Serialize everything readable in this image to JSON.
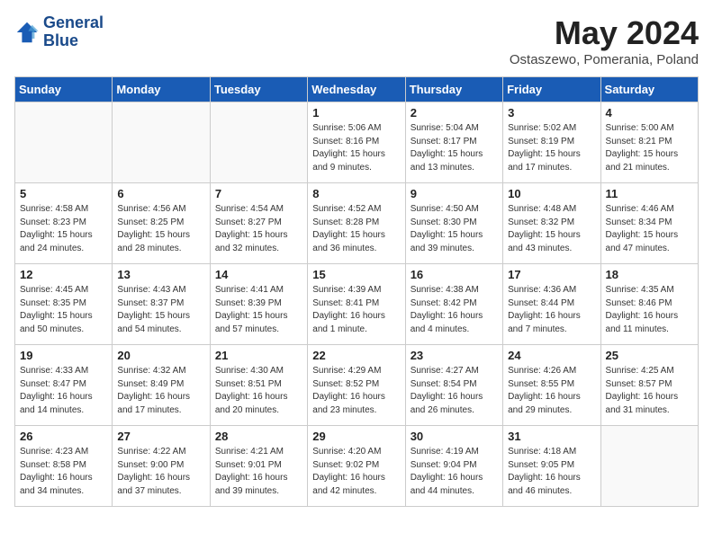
{
  "header": {
    "logo_line1": "General",
    "logo_line2": "Blue",
    "month": "May 2024",
    "location": "Ostaszewo, Pomerania, Poland"
  },
  "days_of_week": [
    "Sunday",
    "Monday",
    "Tuesday",
    "Wednesday",
    "Thursday",
    "Friday",
    "Saturday"
  ],
  "weeks": [
    [
      {
        "day": "",
        "empty": true
      },
      {
        "day": "",
        "empty": true
      },
      {
        "day": "",
        "empty": true
      },
      {
        "day": "1",
        "sunrise": "5:06 AM",
        "sunset": "8:16 PM",
        "daylight": "15 hours and 9 minutes."
      },
      {
        "day": "2",
        "sunrise": "5:04 AM",
        "sunset": "8:17 PM",
        "daylight": "15 hours and 13 minutes."
      },
      {
        "day": "3",
        "sunrise": "5:02 AM",
        "sunset": "8:19 PM",
        "daylight": "15 hours and 17 minutes."
      },
      {
        "day": "4",
        "sunrise": "5:00 AM",
        "sunset": "8:21 PM",
        "daylight": "15 hours and 21 minutes."
      }
    ],
    [
      {
        "day": "5",
        "sunrise": "4:58 AM",
        "sunset": "8:23 PM",
        "daylight": "15 hours and 24 minutes."
      },
      {
        "day": "6",
        "sunrise": "4:56 AM",
        "sunset": "8:25 PM",
        "daylight": "15 hours and 28 minutes."
      },
      {
        "day": "7",
        "sunrise": "4:54 AM",
        "sunset": "8:27 PM",
        "daylight": "15 hours and 32 minutes."
      },
      {
        "day": "8",
        "sunrise": "4:52 AM",
        "sunset": "8:28 PM",
        "daylight": "15 hours and 36 minutes."
      },
      {
        "day": "9",
        "sunrise": "4:50 AM",
        "sunset": "8:30 PM",
        "daylight": "15 hours and 39 minutes."
      },
      {
        "day": "10",
        "sunrise": "4:48 AM",
        "sunset": "8:32 PM",
        "daylight": "15 hours and 43 minutes."
      },
      {
        "day": "11",
        "sunrise": "4:46 AM",
        "sunset": "8:34 PM",
        "daylight": "15 hours and 47 minutes."
      }
    ],
    [
      {
        "day": "12",
        "sunrise": "4:45 AM",
        "sunset": "8:35 PM",
        "daylight": "15 hours and 50 minutes."
      },
      {
        "day": "13",
        "sunrise": "4:43 AM",
        "sunset": "8:37 PM",
        "daylight": "15 hours and 54 minutes."
      },
      {
        "day": "14",
        "sunrise": "4:41 AM",
        "sunset": "8:39 PM",
        "daylight": "15 hours and 57 minutes."
      },
      {
        "day": "15",
        "sunrise": "4:39 AM",
        "sunset": "8:41 PM",
        "daylight": "16 hours and 1 minute."
      },
      {
        "day": "16",
        "sunrise": "4:38 AM",
        "sunset": "8:42 PM",
        "daylight": "16 hours and 4 minutes."
      },
      {
        "day": "17",
        "sunrise": "4:36 AM",
        "sunset": "8:44 PM",
        "daylight": "16 hours and 7 minutes."
      },
      {
        "day": "18",
        "sunrise": "4:35 AM",
        "sunset": "8:46 PM",
        "daylight": "16 hours and 11 minutes."
      }
    ],
    [
      {
        "day": "19",
        "sunrise": "4:33 AM",
        "sunset": "8:47 PM",
        "daylight": "16 hours and 14 minutes."
      },
      {
        "day": "20",
        "sunrise": "4:32 AM",
        "sunset": "8:49 PM",
        "daylight": "16 hours and 17 minutes."
      },
      {
        "day": "21",
        "sunrise": "4:30 AM",
        "sunset": "8:51 PM",
        "daylight": "16 hours and 20 minutes."
      },
      {
        "day": "22",
        "sunrise": "4:29 AM",
        "sunset": "8:52 PM",
        "daylight": "16 hours and 23 minutes."
      },
      {
        "day": "23",
        "sunrise": "4:27 AM",
        "sunset": "8:54 PM",
        "daylight": "16 hours and 26 minutes."
      },
      {
        "day": "24",
        "sunrise": "4:26 AM",
        "sunset": "8:55 PM",
        "daylight": "16 hours and 29 minutes."
      },
      {
        "day": "25",
        "sunrise": "4:25 AM",
        "sunset": "8:57 PM",
        "daylight": "16 hours and 31 minutes."
      }
    ],
    [
      {
        "day": "26",
        "sunrise": "4:23 AM",
        "sunset": "8:58 PM",
        "daylight": "16 hours and 34 minutes."
      },
      {
        "day": "27",
        "sunrise": "4:22 AM",
        "sunset": "9:00 PM",
        "daylight": "16 hours and 37 minutes."
      },
      {
        "day": "28",
        "sunrise": "4:21 AM",
        "sunset": "9:01 PM",
        "daylight": "16 hours and 39 minutes."
      },
      {
        "day": "29",
        "sunrise": "4:20 AM",
        "sunset": "9:02 PM",
        "daylight": "16 hours and 42 minutes."
      },
      {
        "day": "30",
        "sunrise": "4:19 AM",
        "sunset": "9:04 PM",
        "daylight": "16 hours and 44 minutes."
      },
      {
        "day": "31",
        "sunrise": "4:18 AM",
        "sunset": "9:05 PM",
        "daylight": "16 hours and 46 minutes."
      },
      {
        "day": "",
        "empty": true
      }
    ]
  ]
}
